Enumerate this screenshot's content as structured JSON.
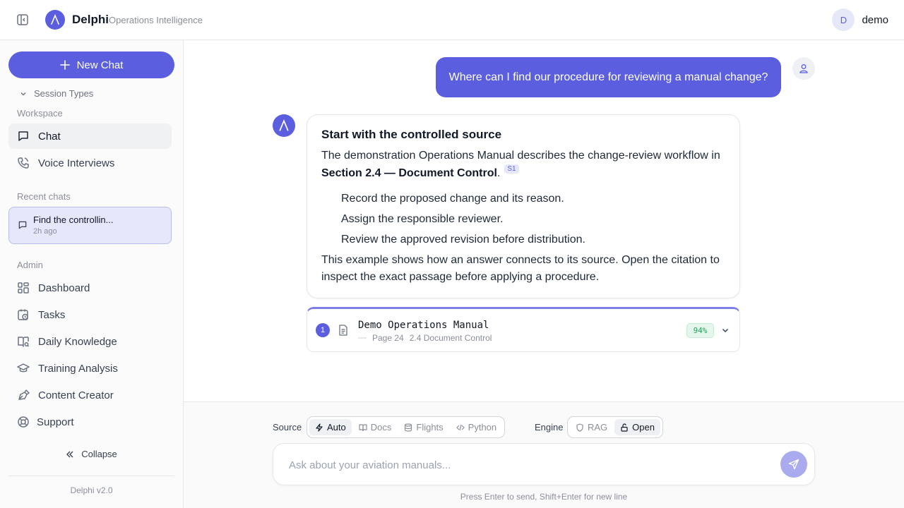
{
  "header": {
    "app_name": "Delphi",
    "subtitle": "Operations Intelligence",
    "avatar_initial": "D",
    "username": "demo"
  },
  "sidebar": {
    "new_chat_label": "New Chat",
    "session_types_label": "Session Types",
    "workspace_label": "Workspace",
    "workspace_items": [
      {
        "label": "Chat",
        "icon": "chat-bubble-icon",
        "active": true
      },
      {
        "label": "Voice Interviews",
        "icon": "phone-icon",
        "active": false
      }
    ],
    "recent_label": "Recent chats",
    "recent_chats": [
      {
        "title": "Find the controllin...",
        "time": "2h ago"
      }
    ],
    "admin_label": "Admin",
    "admin_items": [
      {
        "label": "Dashboard",
        "icon": "dashboard-icon"
      },
      {
        "label": "Tasks",
        "icon": "calendar-clock-icon"
      },
      {
        "label": "Daily Knowledge",
        "icon": "book-open-icon"
      },
      {
        "label": "Training Analysis",
        "icon": "graduation-cap-icon"
      },
      {
        "label": "Content Creator",
        "icon": "pen-tool-icon"
      },
      {
        "label": "Support",
        "icon": "lifebuoy-icon"
      }
    ],
    "collapse_label": "Collapse",
    "version": "Delphi v2.0"
  },
  "conversation": {
    "user_message": "Where can I find our procedure for reviewing a manual change?",
    "answer": {
      "heading": "Start with the controlled source",
      "intro": "The demonstration Operations Manual describes the change-review workflow in",
      "intro_bold": "Section 2.4 — Document Control",
      "intro_end": ".",
      "citation_badge": "S1",
      "steps": [
        "Record the proposed change and its reason.",
        "Assign the responsible reviewer.",
        "Review the approved revision before distribution."
      ],
      "closing": "This example shows how an answer connects to its source. Open the citation to inspect the exact passage before applying a procedure."
    },
    "source": {
      "number": "1",
      "title": "Demo Operations Manual",
      "page": "Page 24",
      "section": "2.4 Document Control",
      "score": "94%"
    }
  },
  "composer": {
    "source_label": "Source",
    "source_options": [
      {
        "label": "Auto",
        "icon": "bolt-icon",
        "selected": true
      },
      {
        "label": "Docs",
        "icon": "book-icon",
        "selected": false
      },
      {
        "label": "Flights",
        "icon": "database-icon",
        "selected": false
      },
      {
        "label": "Python",
        "icon": "code-icon",
        "selected": false
      }
    ],
    "engine_label": "Engine",
    "engine_options": [
      {
        "label": "RAG",
        "icon": "shield-icon",
        "selected": false
      },
      {
        "label": "Open",
        "icon": "unlock-icon",
        "selected": true
      }
    ],
    "placeholder": "Ask about your aviation manuals...",
    "hint": "Press Enter to send, Shift+Enter for new line"
  },
  "colors": {
    "accent": "#5b5fdf",
    "accent_light": "#e6e7fb",
    "score_green": "#22a35a"
  }
}
